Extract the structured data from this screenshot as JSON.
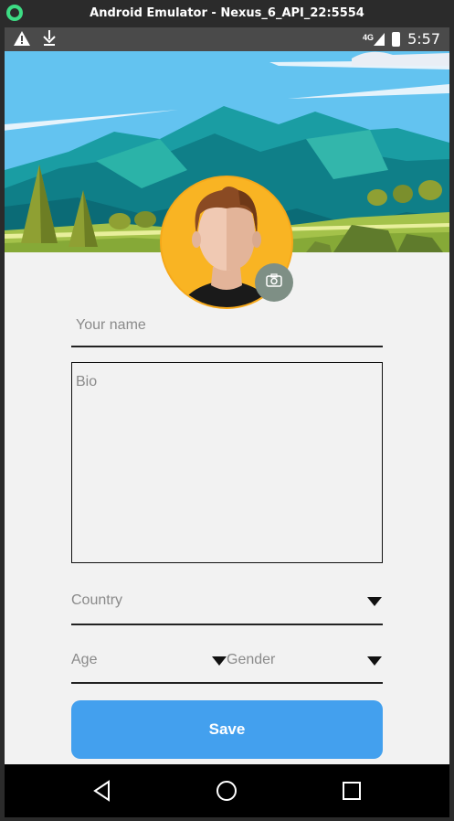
{
  "window": {
    "title": "Android Emulator - Nexus_6_API_22:5554"
  },
  "statusbar": {
    "network": "4G",
    "time": "5:57",
    "icons": [
      "warning-icon",
      "download-icon",
      "signal-icon",
      "battery-icon"
    ]
  },
  "profile": {
    "name_placeholder": "Your name",
    "bio_placeholder": "Bio",
    "country_label": "Country",
    "age_label": "Age",
    "gender_label": "Gender",
    "save_label": "Save"
  },
  "colors": {
    "accent": "#43a0ee",
    "avatar_bg": "#f9b423",
    "camera_bg": "#7e8f85",
    "sky": "#63c3f0"
  },
  "navbar": {
    "icons": [
      "back-icon",
      "home-icon",
      "recents-icon"
    ]
  }
}
